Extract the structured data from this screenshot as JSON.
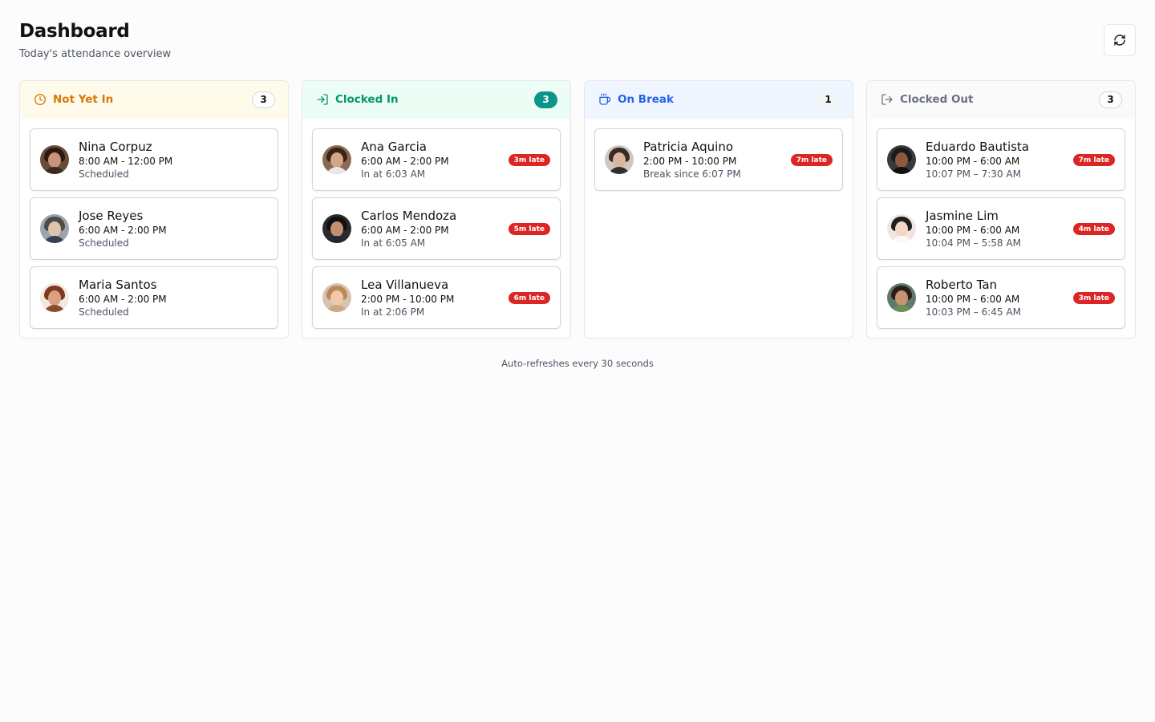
{
  "header": {
    "title": "Dashboard",
    "subtitle": "Today's attendance overview",
    "refresh_icon": "refresh-icon"
  },
  "columns": {
    "not_yet_in": {
      "title": "Not Yet In",
      "count": "3",
      "icon": "clock-icon",
      "accent": "#d97706",
      "cards": [
        {
          "name": "Nina Corpuz",
          "shift": "8:00 AM - 12:00 PM",
          "detail": "Scheduled"
        },
        {
          "name": "Jose Reyes",
          "shift": "6:00 AM - 2:00 PM",
          "detail": "Scheduled"
        },
        {
          "name": "Maria Santos",
          "shift": "6:00 AM - 2:00 PM",
          "detail": "Scheduled"
        }
      ]
    },
    "clocked_in": {
      "title": "Clocked In",
      "count": "3",
      "icon": "log-in-icon",
      "accent": "#059669",
      "cards": [
        {
          "name": "Ana Garcia",
          "shift": "6:00 AM - 2:00 PM",
          "detail": "In at 6:03 AM",
          "badge": "3m late"
        },
        {
          "name": "Carlos Mendoza",
          "shift": "6:00 AM - 2:00 PM",
          "detail": "In at 6:05 AM",
          "badge": "5m late"
        },
        {
          "name": "Lea Villanueva",
          "shift": "2:00 PM - 10:00 PM",
          "detail": "In at 2:06 PM",
          "badge": "6m late"
        }
      ]
    },
    "on_break": {
      "title": "On Break",
      "count": "1",
      "icon": "coffee-icon",
      "accent": "#2563eb",
      "cards": [
        {
          "name": "Patricia Aquino",
          "shift": "2:00 PM - 10:00 PM",
          "detail": "Break since 6:07 PM",
          "badge": "7m late"
        }
      ]
    },
    "clocked_out": {
      "title": "Clocked Out",
      "count": "3",
      "icon": "log-out-icon",
      "accent": "#6b7280",
      "cards": [
        {
          "name": "Eduardo Bautista",
          "shift": "10:00 PM - 6:00 AM",
          "detail": "10:07 PM – 7:30 AM",
          "badge": "7m late"
        },
        {
          "name": "Jasmine Lim",
          "shift": "10:00 PM - 6:00 AM",
          "detail": "10:04 PM – 5:58 AM",
          "badge": "4m late"
        },
        {
          "name": "Roberto Tan",
          "shift": "10:00 PM - 6:00 AM",
          "detail": "10:03 PM – 6:45 AM",
          "badge": "3m late"
        }
      ]
    }
  },
  "footer": {
    "note": "Auto-refreshes every 30 seconds"
  },
  "colors": {
    "late_badge": "#dc2626",
    "count_teal": "#0d9488"
  }
}
